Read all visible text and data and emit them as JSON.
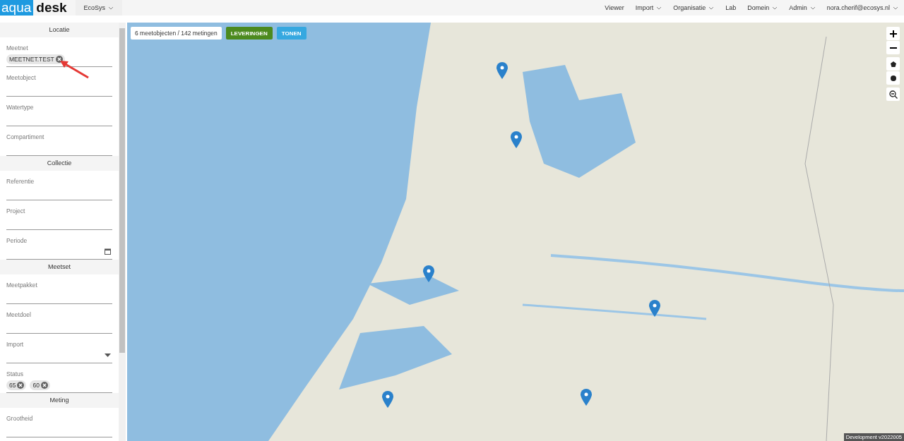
{
  "header": {
    "logo": {
      "part_1": "aqua",
      "part_2": "desk"
    },
    "workspace": "EcoSys",
    "nav": [
      {
        "label": "Viewer",
        "dropdown": false
      },
      {
        "label": "Import",
        "dropdown": true
      },
      {
        "label": "Organisatie",
        "dropdown": true
      },
      {
        "label": "Lab",
        "dropdown": false
      },
      {
        "label": "Domein",
        "dropdown": true
      },
      {
        "label": "Admin",
        "dropdown": true
      },
      {
        "label": "nora.cherif@ecosys.nl",
        "dropdown": true
      }
    ]
  },
  "sidebar": {
    "sections": [
      {
        "title": "Locatie",
        "fields": [
          {
            "label": "Meetnet",
            "kind": "chips",
            "chips": [
              "MEETNET.TEST"
            ]
          },
          {
            "label": "Meetobject",
            "kind": "text"
          },
          {
            "label": "Watertype",
            "kind": "text"
          },
          {
            "label": "Compartiment",
            "kind": "text"
          }
        ]
      },
      {
        "title": "Collectie",
        "fields": [
          {
            "label": "Referentie",
            "kind": "text"
          },
          {
            "label": "Project",
            "kind": "text"
          },
          {
            "label": "Periode",
            "kind": "date"
          }
        ]
      },
      {
        "title": "Meetset",
        "fields": [
          {
            "label": "Meetpakket",
            "kind": "text"
          },
          {
            "label": "Meetdoel",
            "kind": "text"
          },
          {
            "label": "Import",
            "kind": "select"
          },
          {
            "label": "Status",
            "kind": "chips",
            "chips": [
              "65",
              "60"
            ]
          }
        ]
      },
      {
        "title": "Meting",
        "fields": [
          {
            "label": "Grootheid",
            "kind": "text"
          }
        ]
      }
    ]
  },
  "map": {
    "summary": "6 meetobjecten / 142 metingen",
    "buttons": [
      {
        "label": "LEVERINGEN",
        "kind": "primary"
      },
      {
        "label": "TONEN",
        "kind": "secondary"
      }
    ],
    "version": "Development v2022005"
  }
}
